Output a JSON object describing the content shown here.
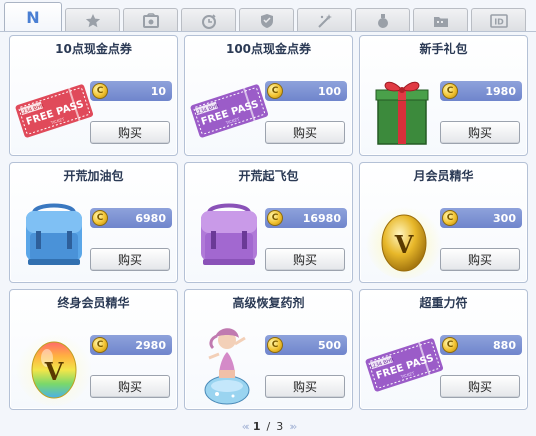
{
  "tabs": [
    {
      "id": "new",
      "label": "N",
      "icon": "new-icon",
      "active": true
    },
    {
      "id": "star",
      "label": "",
      "icon": "star-icon"
    },
    {
      "id": "costume",
      "label": "",
      "icon": "costume-icon"
    },
    {
      "id": "time",
      "label": "",
      "icon": "timer-icon"
    },
    {
      "id": "armor",
      "label": "",
      "icon": "shield-icon"
    },
    {
      "id": "magic",
      "label": "",
      "icon": "magic-icon"
    },
    {
      "id": "potion",
      "label": "",
      "icon": "potion-icon"
    },
    {
      "id": "folder",
      "label": "",
      "icon": "folder-icon"
    },
    {
      "id": "id",
      "label": "ID",
      "icon": "id-icon"
    }
  ],
  "coin_symbol": "C",
  "buy_label": "购买",
  "items": [
    {
      "name": "10点现金点券",
      "price": "10",
      "art": "ticket-red"
    },
    {
      "name": "100点现金点券",
      "price": "100",
      "art": "ticket-purple"
    },
    {
      "name": "新手礼包",
      "price": "1980",
      "art": "gift-box"
    },
    {
      "name": "开荒加油包",
      "price": "6980",
      "art": "backpack-blue"
    },
    {
      "name": "开荒起飞包",
      "price": "16980",
      "art": "backpack-purple"
    },
    {
      "name": "月会员精华",
      "price": "300",
      "art": "egg-gold"
    },
    {
      "name": "终身会员精华",
      "price": "2980",
      "art": "egg-rainbow"
    },
    {
      "name": "高级恢复药剂",
      "price": "500",
      "art": "potion-girl"
    },
    {
      "name": "超重力符",
      "price": "880",
      "art": "ticket-purple-2"
    }
  ],
  "ticket_text": {
    "top": "1234 BHR",
    "main": "FREE PASS",
    "sub": "TICKET"
  },
  "egg_letter": "V",
  "pager": {
    "current": "1",
    "separator": "/",
    "total": "3"
  },
  "colors": {
    "price_bar": "#7b8fd2",
    "accent_tab": "#4a7fd3",
    "card_border": "#b4c1d6"
  }
}
